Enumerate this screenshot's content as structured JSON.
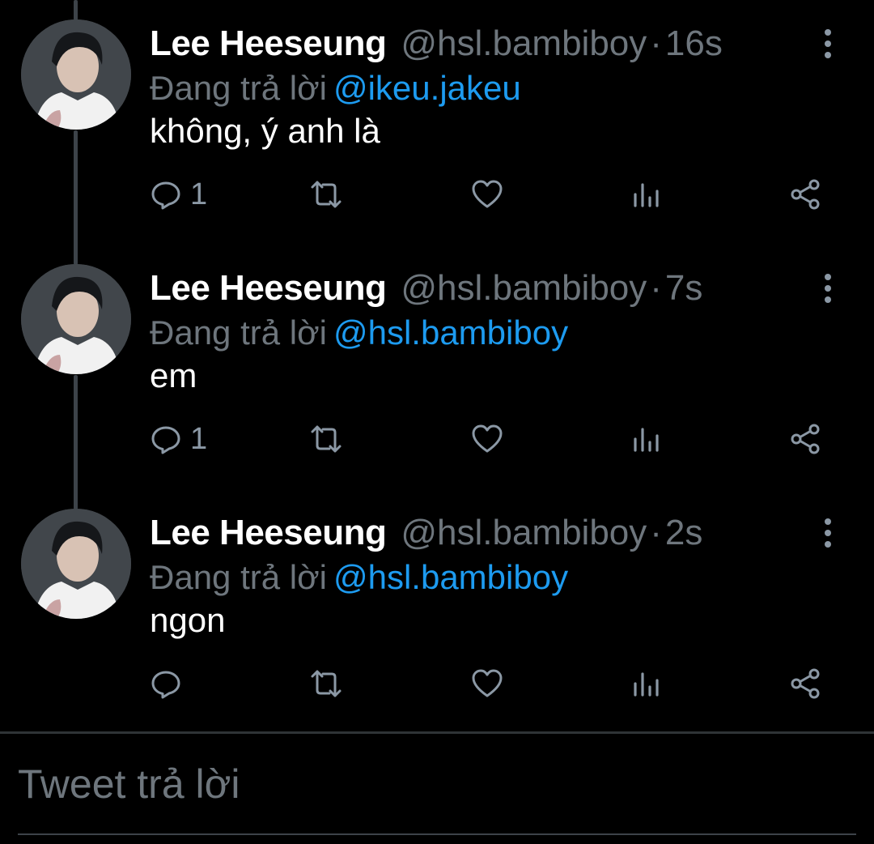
{
  "tweets": [
    {
      "display_name": "Lee Heeseung",
      "handle": "@hsl.bambiboy",
      "separator": "·",
      "time": "16s",
      "reply_prefix": "Đang trả lời",
      "reply_to": "@ikeu.jakeu",
      "text": "không, ý anh là",
      "reply_count": "1"
    },
    {
      "display_name": "Lee Heeseung",
      "handle": "@hsl.bambiboy",
      "separator": "·",
      "time": "7s",
      "reply_prefix": "Đang trả lời",
      "reply_to": "@hsl.bambiboy",
      "text": "em",
      "reply_count": "1"
    },
    {
      "display_name": "Lee Heeseung",
      "handle": "@hsl.bambiboy",
      "separator": "·",
      "time": "2s",
      "reply_prefix": "Đang trả lời",
      "reply_to": "@hsl.bambiboy",
      "text": "ngon",
      "reply_count": ""
    }
  ],
  "compose": {
    "placeholder": "Tweet trả lời"
  },
  "icons": {
    "reply": "reply-icon",
    "retweet": "retweet-icon",
    "like": "heart-icon",
    "analytics": "analytics-icon",
    "share": "share-icon",
    "more": "more-vertical-icon"
  },
  "colors": {
    "background": "#000000",
    "mention": "#1d9bf0",
    "secondary_text": "#6e767d",
    "icon": "#8b98a5"
  }
}
